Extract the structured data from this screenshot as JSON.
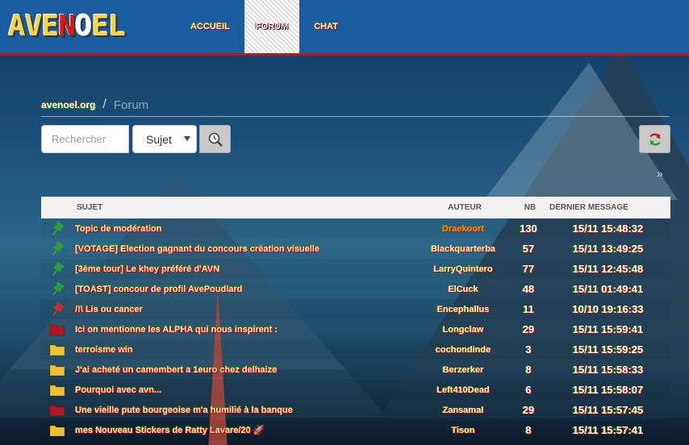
{
  "site": {
    "logo_text": "AVENOEL"
  },
  "nav": {
    "items": [
      {
        "label": "ACCUEIL"
      },
      {
        "label": "FORUM",
        "active": true
      },
      {
        "label": "CHAT"
      }
    ]
  },
  "breadcrumb": {
    "home": "avenoel.org",
    "separator": "/",
    "current": "Forum"
  },
  "search": {
    "placeholder": "Rechercher",
    "select_value": "Sujet"
  },
  "table": {
    "headers": {
      "subject": "SUJET",
      "author": "AUTEUR",
      "nb": "NB",
      "last": "DERNIER MESSAGE"
    },
    "rows": [
      {
        "icon": "pin-green-icon",
        "subject": "Topic de modération",
        "author": "Draekoort",
        "author_role": "moderator",
        "nb": "130",
        "last": "15/11 15:48:32"
      },
      {
        "icon": "pin-green-icon",
        "subject": "[VOTAGE] Election gagnant du concours création visuelle",
        "author": "Blackquarterba",
        "nb": "57",
        "last": "15/11 13:49:25"
      },
      {
        "icon": "pin-green-icon",
        "subject": "[3ème tour] Le khey préféré d'AVN",
        "author": "LarryQuintero",
        "nb": "77",
        "last": "15/11 12:45:48"
      },
      {
        "icon": "pin-green-icon",
        "subject": "[TOAST] concour de profil AvePoudlard",
        "author": "ElCuck",
        "nb": "48",
        "last": "15/11 01:49:41"
      },
      {
        "icon": "pin-red-icon",
        "subject": "/!\\ Lis ou cancer",
        "author": "Encephallus",
        "nb": "11",
        "last": "10/10 19:16:33"
      },
      {
        "icon": "folder-red-icon",
        "subject": "Ici on mentionne les ALPHA qui nous inspirent :",
        "author": "Longclaw",
        "nb": "29",
        "last": "15/11 15:59:41"
      },
      {
        "icon": "folder-yellow-icon",
        "subject": "terroisme win",
        "author": "cochondinde",
        "nb": "3",
        "last": "15/11 15:59:25"
      },
      {
        "icon": "folder-yellow-icon",
        "subject": "J'ai acheté un camembert a 1euro chez delhaize",
        "author": "Berzerker",
        "nb": "8",
        "last": "15/11 15:58:33"
      },
      {
        "icon": "folder-yellow-icon",
        "subject": "Pourquoi avec avn...",
        "author": "Left410Dead",
        "nb": "6",
        "last": "15/11 15:58:07"
      },
      {
        "icon": "folder-red-icon",
        "subject": "Une vieille pute bourgeoise m'a humilié à la banque",
        "author": "Zansamal",
        "nb": "29",
        "last": "15/11 15:57:45"
      },
      {
        "icon": "folder-yellow-icon",
        "subject": "mes Nouveau Stickers de Ratty Lavare/20 🚀",
        "author": "Tison",
        "nb": "8",
        "last": "15/11 15:57:41"
      }
    ]
  },
  "colors": {
    "header_bg": "#1a5ca0",
    "accent_red": "#c0151a",
    "pin_green": "#2e9e3a",
    "pin_red": "#c9302c",
    "folder_yellow": "#f0c030",
    "folder_red": "#b0191d",
    "moderator": "#ff8a1a"
  }
}
